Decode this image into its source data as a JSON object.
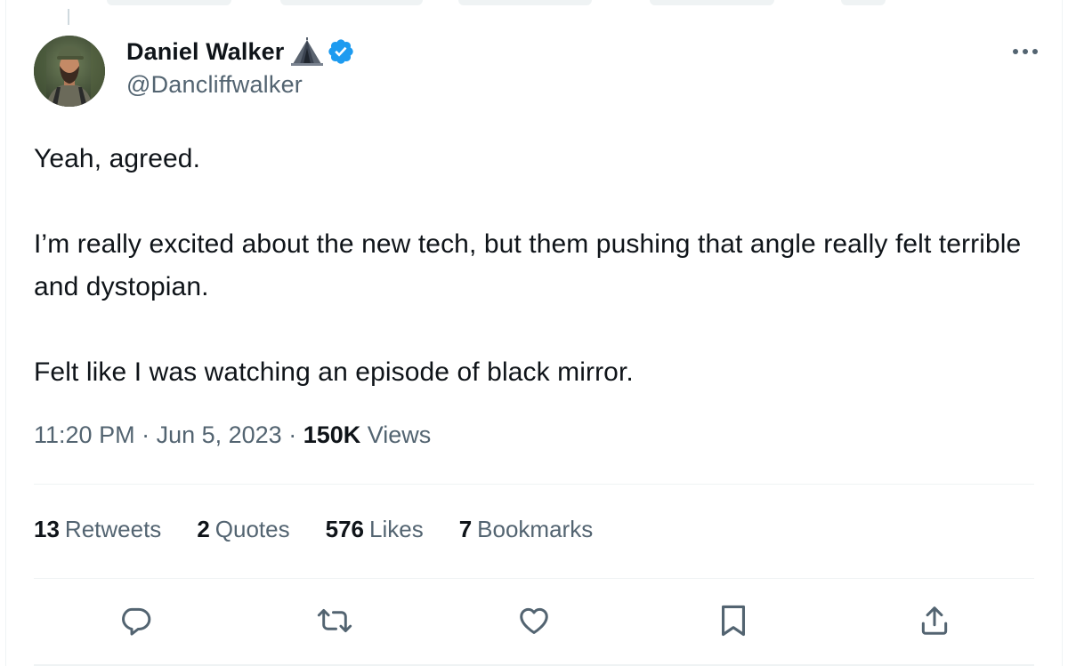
{
  "author": {
    "display_name": "Daniel Walker",
    "name_emoji_icon": "camping-tent-icon",
    "verified_icon": "verified-badge-icon",
    "handle": "@Dancliffwalker"
  },
  "more_icon": "more-options-icon",
  "tweet": {
    "paragraphs": [
      "Yeah, agreed.",
      "I’m really excited about the new tech, but them pushing that angle really felt terrible and dystopian.",
      "Felt like I was watching an episode of black mirror."
    ]
  },
  "meta": {
    "time": "11:20 PM",
    "separator": " · ",
    "date": "Jun 5, 2023",
    "views_count": "150K",
    "views_label": "Views"
  },
  "stats": [
    {
      "count": "13",
      "label": "Retweets"
    },
    {
      "count": "2",
      "label": "Quotes"
    },
    {
      "count": "576",
      "label": "Likes"
    },
    {
      "count": "7",
      "label": "Bookmarks"
    }
  ],
  "actions": [
    {
      "name": "reply",
      "icon": "reply-icon"
    },
    {
      "name": "retweet",
      "icon": "retweet-icon"
    },
    {
      "name": "like",
      "icon": "heart-icon"
    },
    {
      "name": "bookmark",
      "icon": "bookmark-icon"
    },
    {
      "name": "share",
      "icon": "share-icon"
    }
  ],
  "colors": {
    "text_primary": "#0f1419",
    "text_secondary": "#536471",
    "verified_blue": "#1d9bf0",
    "divider": "#eff3f4"
  }
}
